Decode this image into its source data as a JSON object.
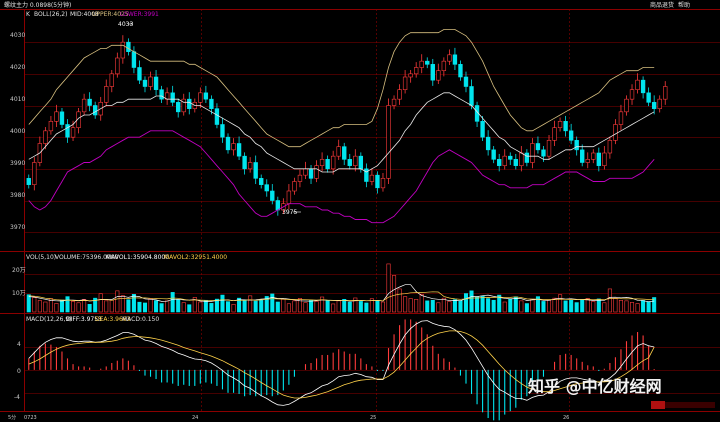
{
  "window": {
    "title": "螺纹主力 0.0898(5分钟)",
    "buttons": [
      "商品退货",
      "帮助"
    ]
  },
  "colors": {
    "background": "#000000",
    "grid": "#8b0000",
    "up_candle": "#ff3b3b",
    "down_candle": "#00e5ee",
    "mid": "#e8e8e8",
    "upper": "#d8c080",
    "lower": "#c000c0",
    "mavol1": "#ffffff",
    "mavol2": "#ffd24a",
    "diff": "#ffffff",
    "dea": "#ffd24a",
    "macd_up": "#ff3b3b",
    "macd_down": "#00e5ee"
  },
  "boll_header": {
    "k_label": "K",
    "boll": "BOLL(26,2)",
    "mid": "MID:4008",
    "upper": "UPPER:4025",
    "lower": "LOWER:3991"
  },
  "vol_header": {
    "vol": "VOL(5,10)",
    "volume": "VOLUME:75396.0000",
    "mavol1": "MAVOL1:35904.8000",
    "mavol2": "MAVOL2:32951.4000"
  },
  "macd_header": {
    "macd": "MACD(12,26,9)",
    "diff": "DIFF:3.9753",
    "dea": "DEA:3.9663",
    "macd_val": "MACD:0.150"
  },
  "price_axis": [
    "4030",
    "4020",
    "4010",
    "4000",
    "3990",
    "3980",
    "3970"
  ],
  "vol_axis": [
    "20万",
    "10万"
  ],
  "macd_axis": [
    "4",
    "0",
    "-4"
  ],
  "time_axis": [
    "5分",
    "0723",
    "24",
    "25",
    "26"
  ],
  "annotations": {
    "high": "4033",
    "low": "3975"
  },
  "watermark": {
    "text": "知乎 @中亿财经网",
    "logo": "zhongyi"
  },
  "chart_data": [
    {
      "type": "candlestick",
      "title": "BOLL(26,2)",
      "ylim": [
        3965,
        4037
      ],
      "yticks": [
        4030,
        4020,
        4010,
        4000,
        3990,
        3980,
        3970
      ],
      "close": [
        3985,
        3992,
        3998,
        4002,
        4005,
        4008,
        4004,
        4000,
        4003,
        4008,
        4012,
        4010,
        4007,
        4011,
        4016,
        4020,
        4025,
        4030,
        4027,
        4022,
        4018,
        4016,
        4019,
        4015,
        4012,
        4014,
        4011,
        4008,
        4012,
        4009,
        4011,
        4014,
        4012,
        4009,
        4004,
        4000,
        3996,
        3998,
        3994,
        3990,
        3992,
        3987,
        3985,
        3983,
        3980,
        3977,
        3979,
        3983,
        3986,
        3988,
        3990,
        3987,
        3991,
        3993,
        3990,
        3994,
        3997,
        3993,
        3991,
        3994,
        3990,
        3986,
        3988,
        3984,
        3987,
        4010,
        4012,
        4015,
        4019,
        4020,
        4022,
        4024,
        4023,
        4018,
        4021,
        4024,
        4026,
        4023,
        4019,
        4016,
        4010,
        4005,
        4000,
        3996,
        3993,
        3991,
        3994,
        3993,
        3991,
        3995,
        3992,
        3998,
        3996,
        3994,
        3999,
        4003,
        4005,
        4002,
        3999,
        3996,
        3992,
        3993,
        3995,
        3991,
        3995,
        3999,
        4004,
        4008,
        4012,
        4015,
        4018,
        4014,
        4011,
        4009,
        4012,
        4016
      ],
      "mid": [
        3993,
        3994,
        3995,
        3997,
        3999,
        4001,
        4002,
        4003,
        4004,
        4006,
        4007,
        4007,
        4008,
        4009,
        4010,
        4010,
        4011,
        4011,
        4012,
        4012,
        4012,
        4012,
        4012,
        4013,
        4013,
        4012,
        4012,
        4012,
        4011,
        4011,
        4010,
        4010,
        4009,
        4008,
        4007,
        4006,
        4005,
        4004,
        4003,
        4001,
        4000,
        3998,
        3997,
        3995,
        3994,
        3993,
        3992,
        3991,
        3990,
        3990,
        3990,
        3990,
        3990,
        3989,
        3989,
        3989,
        3990,
        3990,
        3990,
        3990,
        3990,
        3989,
        3990,
        3991,
        3993,
        3995,
        3997,
        3999,
        4002,
        4004,
        4007,
        4009,
        4011,
        4012,
        4013,
        4014,
        4014,
        4013,
        4012,
        4011,
        4010,
        4008,
        4006,
        4004,
        4002,
        4000,
        3999,
        3997,
        3996,
        3995,
        3994,
        3994,
        3994,
        3993,
        3993,
        3994,
        3995,
        3996,
        3996,
        3997,
        3997,
        3997,
        3997,
        3998,
        3999,
        4000,
        4001,
        4002,
        4003,
        4004,
        4005,
        4006,
        4007,
        4008
      ],
      "upper": [
        4004,
        4006,
        4008,
        4010,
        4012,
        4015,
        4017,
        4019,
        4021,
        4023,
        4025,
        4026,
        4027,
        4028,
        4028,
        4029,
        4029,
        4029,
        4028,
        4027,
        4026,
        4025,
        4024,
        4024,
        4024,
        4024,
        4024,
        4024,
        4024,
        4023,
        4023,
        4022,
        4021,
        4020,
        4019,
        4017,
        4015,
        4013,
        4011,
        4009,
        4007,
        4005,
        4003,
        4001,
        4000,
        3999,
        3998,
        3997,
        3997,
        3997,
        3998,
        3999,
        4000,
        4001,
        4002,
        4003,
        4003,
        4004,
        4004,
        4004,
        4004,
        4004,
        4005,
        4009,
        4015,
        4022,
        4027,
        4030,
        4032,
        4033,
        4033,
        4033,
        4033,
        4033,
        4033,
        4034,
        4034,
        4034,
        4033,
        4032,
        4030,
        4027,
        4024,
        4020,
        4016,
        4013,
        4010,
        4007,
        4005,
        4003,
        4002,
        4002,
        4003,
        4004,
        4005,
        4006,
        4007,
        4008,
        4009,
        4010,
        4011,
        4012,
        4013,
        4014,
        4016,
        4018,
        4019,
        4020,
        4021,
        4021,
        4021,
        4022,
        4022,
        4022
      ],
      "lower": [
        3980,
        3978,
        3977,
        3978,
        3980,
        3983,
        3986,
        3989,
        3990,
        3991,
        3992,
        3992,
        3993,
        3994,
        3996,
        3997,
        3998,
        3999,
        4000,
        4000,
        4000,
        4001,
        4002,
        4002,
        4002,
        4002,
        4002,
        4001,
        4000,
        3999,
        3998,
        3997,
        3995,
        3993,
        3991,
        3989,
        3987,
        3985,
        3982,
        3980,
        3978,
        3976,
        3975,
        3975,
        3976,
        3977,
        3978,
        3979,
        3979,
        3979,
        3978,
        3978,
        3978,
        3977,
        3977,
        3976,
        3976,
        3975,
        3975,
        3974,
        3974,
        3974,
        3973,
        3973,
        3973,
        3974,
        3975,
        3977,
        3979,
        3981,
        3983,
        3986,
        3989,
        3992,
        3994,
        3995,
        3996,
        3995,
        3994,
        3993,
        3992,
        3990,
        3988,
        3987,
        3986,
        3985,
        3985,
        3984,
        3984,
        3984,
        3984,
        3985,
        3985,
        3985,
        3986,
        3987,
        3988,
        3989,
        3989,
        3989,
        3988,
        3987,
        3986,
        3986,
        3986,
        3987,
        3987,
        3987,
        3987,
        3987,
        3988,
        3989,
        3991,
        3993
      ]
    },
    {
      "type": "bar",
      "title": "VOL(5,10)",
      "ylim": [
        0,
        260000
      ],
      "values": [
        90000,
        75000,
        60000,
        52000,
        70000,
        45000,
        62000,
        80000,
        55000,
        48000,
        66000,
        40000,
        72000,
        95000,
        58000,
        61000,
        110000,
        85000,
        64000,
        92000,
        51000,
        47000,
        70000,
        59000,
        44000,
        58000,
        102000,
        63000,
        49000,
        38000,
        76000,
        52000,
        61000,
        45000,
        67000,
        88000,
        54000,
        40000,
        72000,
        60000,
        84000,
        57000,
        62000,
        81000,
        94000,
        52000,
        66000,
        43000,
        58000,
        71000,
        49000,
        62000,
        55000,
        78000,
        61000,
        42000,
        58000,
        66000,
        51000,
        73000,
        55000,
        47000,
        69000,
        60000,
        52000,
        250000,
        190000,
        120000,
        80000,
        70000,
        66000,
        92000,
        58000,
        61000,
        48000,
        72000,
        55000,
        64000,
        58000,
        96000,
        110000,
        78000,
        84000,
        70000,
        61000,
        88000,
        52000,
        68000,
        79000,
        58000,
        44000,
        67000,
        80000,
        55000,
        61000,
        72000,
        90000,
        58000,
        62000,
        49000,
        64000,
        71000,
        55000,
        68000,
        48000,
        120000,
        72000,
        61000,
        58000,
        50000,
        44000,
        60000,
        54000,
        75396
      ],
      "mavol1": [
        80000,
        78000,
        72000,
        66000,
        60000,
        58000,
        57000,
        62000,
        62000,
        60000,
        63000,
        57000,
        60000,
        66000,
        66000,
        65000,
        80000,
        82000,
        76000,
        83000,
        80000,
        68000,
        66000,
        63000,
        55000,
        56000,
        66000,
        66000,
        63000,
        62000,
        65000,
        57000,
        55000,
        55000,
        60000,
        62000,
        63000,
        59000,
        64000,
        63000,
        62000,
        63000,
        67000,
        69000,
        76000,
        70000,
        71000,
        67000,
        63000,
        58000,
        57000,
        56000,
        59000,
        63000,
        61000,
        60000,
        59000,
        61000,
        56000,
        58000,
        61000,
        58000,
        59000,
        61000,
        57000,
        96000,
        116000,
        130000,
        142000,
        142000,
        106000,
        86000,
        77000,
        69000,
        66000,
        66000,
        59000,
        60000,
        59000,
        69000,
        80000,
        80000,
        85000,
        88000,
        81000,
        76000,
        71000,
        68000,
        70000,
        69000,
        60000,
        63000,
        66000,
        61000,
        61000,
        67000,
        72000,
        67000,
        69000,
        66000,
        65000,
        63000,
        60000,
        61000,
        61000,
        76000,
        77000,
        74000,
        76000,
        72000,
        61000,
        59000,
        53000,
        57000
      ],
      "mavol2": [
        85000,
        82000,
        78000,
        72000,
        68000,
        64000,
        62000,
        62000,
        60000,
        58000,
        60000,
        59000,
        60000,
        64000,
        64000,
        61000,
        68000,
        71000,
        70000,
        74000,
        73000,
        74000,
        71000,
        70000,
        69000,
        68000,
        73000,
        71000,
        66000,
        61000,
        63000,
        62000,
        61000,
        60000,
        61000,
        64000,
        62000,
        59000,
        61000,
        61000,
        64000,
        61000,
        63000,
        66000,
        69000,
        68000,
        67000,
        65000,
        65000,
        65000,
        64000,
        63000,
        62000,
        64000,
        62000,
        61000,
        61000,
        61000,
        60000,
        61000,
        60000,
        59000,
        60000,
        60000,
        58000,
        77000,
        87000,
        93000,
        95000,
        100000,
        101000,
        101000,
        103000,
        105000,
        104000,
        81000,
        73000,
        68000,
        66000,
        68000,
        73000,
        73000,
        75000,
        76000,
        75000,
        78000,
        75000,
        76000,
        79000,
        75000,
        68000,
        67000,
        67000,
        65000,
        65000,
        64000,
        67000,
        66000,
        65000,
        64000,
        65000,
        67000,
        64000,
        65000,
        64000,
        70000,
        70000,
        69000,
        68000,
        69000,
        68000,
        67000,
        65000,
        66000
      ]
    },
    {
      "type": "bar",
      "title": "MACD(12,26,9)",
      "ylim": [
        -7,
        8
      ],
      "yticks": [
        4,
        0,
        -4
      ],
      "diff": [
        2.0,
        3.0,
        4.0,
        4.8,
        5.3,
        5.6,
        5.6,
        5.3,
        5.0,
        4.9,
        5.0,
        5.0,
        4.8,
        4.9,
        5.2,
        5.6,
        6.0,
        6.5,
        6.5,
        6.2,
        5.7,
        5.2,
        5.0,
        4.6,
        4.1,
        3.8,
        3.4,
        2.9,
        2.6,
        2.2,
        1.9,
        1.8,
        1.6,
        1.2,
        0.6,
        -0.1,
        -0.9,
        -1.4,
        -2.0,
        -2.8,
        -3.2,
        -3.9,
        -4.5,
        -5.0,
        -5.6,
        -6.1,
        -6.2,
        -6.0,
        -5.5,
        -4.9,
        -4.3,
        -4.0,
        -3.4,
        -2.8,
        -2.5,
        -1.9,
        -1.2,
        -1.0,
        -0.9,
        -0.6,
        -0.8,
        -1.2,
        -1.3,
        -1.7,
        -1.7,
        0.8,
        2.7,
        4.5,
        6.1,
        7.2,
        8.0,
        8.5,
        8.6,
        8.1,
        7.8,
        7.6,
        7.5,
        7.0,
        6.2,
        5.2,
        3.8,
        2.2,
        0.6,
        -1.0,
        -2.3,
        -3.4,
        -3.9,
        -4.5,
        -5.0,
        -5.0,
        -5.3,
        -4.8,
        -4.5,
        -4.4,
        -3.8,
        -2.9,
        -2.0,
        -1.6,
        -1.4,
        -1.4,
        -1.6,
        -1.8,
        -1.8,
        -2.2,
        -2.0,
        -1.4,
        -0.6,
        0.6,
        1.9,
        3.1,
        4.2,
        4.6,
        4.2,
        3.98
      ],
      "dea": [
        1.0,
        1.4,
        1.9,
        2.5,
        3.1,
        3.6,
        4.0,
        4.3,
        4.5,
        4.6,
        4.7,
        4.8,
        4.8,
        4.8,
        4.9,
        5.0,
        5.2,
        5.5,
        5.7,
        5.8,
        5.8,
        5.7,
        5.6,
        5.4,
        5.2,
        4.9,
        4.6,
        4.3,
        3.9,
        3.6,
        3.3,
        3.0,
        2.7,
        2.4,
        2.0,
        1.6,
        1.1,
        0.6,
        0.1,
        -0.5,
        -1.0,
        -1.6,
        -2.2,
        -2.8,
        -3.3,
        -3.9,
        -4.4,
        -4.7,
        -4.9,
        -4.9,
        -4.8,
        -4.6,
        -4.4,
        -4.1,
        -3.8,
        -3.4,
        -3.0,
        -2.6,
        -2.3,
        -2.0,
        -1.8,
        -1.7,
        -1.6,
        -1.6,
        -1.6,
        -1.1,
        -0.4,
        0.6,
        1.7,
        2.8,
        3.8,
        4.8,
        5.5,
        6.0,
        6.4,
        6.6,
        6.8,
        6.8,
        6.7,
        6.4,
        5.9,
        5.2,
        4.3,
        3.2,
        2.1,
        1.0,
        0.0,
        -0.9,
        -1.7,
        -2.4,
        -3.0,
        -3.4,
        -3.6,
        -3.8,
        -3.8,
        -3.6,
        -3.3,
        -3.0,
        -2.7,
        -2.4,
        -2.3,
        -2.2,
        -2.1,
        -2.1,
        -2.1,
        -2.0,
        -1.7,
        -1.2,
        -0.6,
        0.1,
        0.9,
        1.6,
        2.1,
        3.97
      ],
      "macd": [
        2.0,
        3.2,
        4.2,
        4.6,
        4.4,
        4.0,
        3.2,
        2.0,
        1.0,
        0.6,
        0.6,
        0.4,
        0.0,
        0.2,
        0.6,
        1.2,
        1.6,
        2.0,
        1.6,
        0.8,
        -0.2,
        -1.0,
        -1.2,
        -1.6,
        -2.2,
        -2.2,
        -2.4,
        -2.8,
        -2.6,
        -2.8,
        -2.8,
        -2.4,
        -2.2,
        -2.4,
        -2.8,
        -3.4,
        -4.0,
        -4.0,
        -4.2,
        -4.6,
        -4.4,
        -4.6,
        -4.6,
        -4.4,
        -4.6,
        -4.4,
        -3.6,
        -2.6,
        -1.2,
        0.0,
        1.0,
        1.2,
        2.0,
        2.6,
        2.6,
        3.0,
        3.6,
        3.2,
        2.8,
        2.8,
        2.0,
        1.0,
        0.6,
        -0.2,
        -0.2,
        3.8,
        6.2,
        7.8,
        8.8,
        8.8,
        8.4,
        7.4,
        6.2,
        4.2,
        2.8,
        2.0,
        1.4,
        0.4,
        -1.0,
        -2.4,
        -4.2,
        -6.0,
        -7.4,
        -8.4,
        -8.8,
        -8.8,
        -7.8,
        -7.2,
        -6.6,
        -5.2,
        -4.6,
        -2.8,
        -1.8,
        -1.2,
        0.0,
        1.4,
        2.6,
        2.8,
        2.6,
        2.0,
        1.4,
        0.8,
        0.6,
        -0.2,
        0.2,
        1.2,
        2.2,
        3.6,
        5.0,
        6.0,
        6.6,
        6.0,
        4.2,
        0.15
      ]
    }
  ]
}
